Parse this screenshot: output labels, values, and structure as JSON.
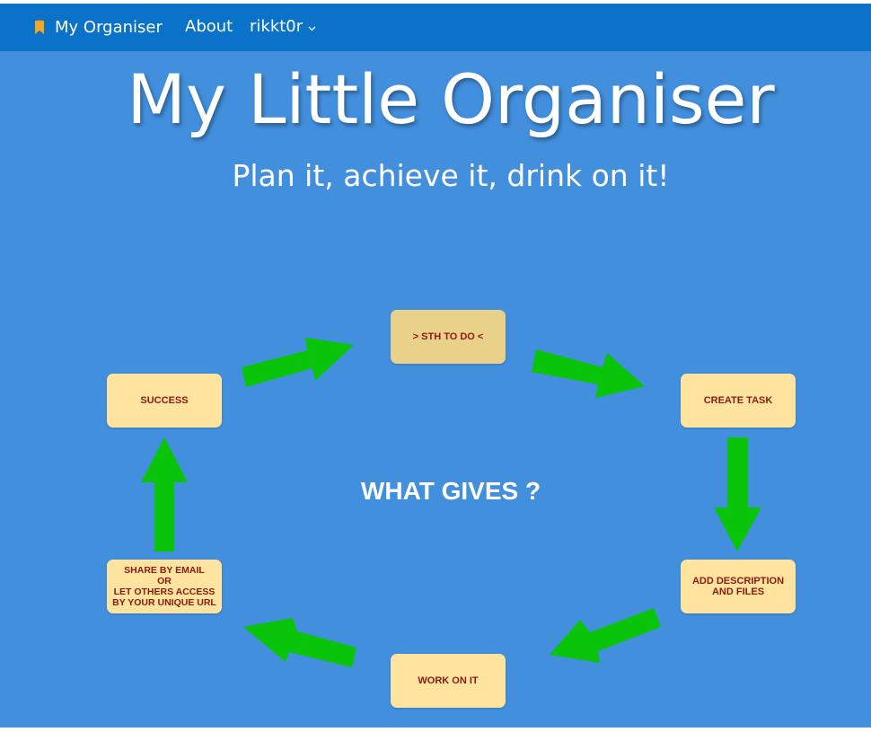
{
  "navbar": {
    "brand_label": "My Organiser",
    "brand_icon": "bookmark-icon",
    "about_label": "About",
    "user_label": "rikkt0r",
    "user_icon": "chevron-down-icon"
  },
  "hero": {
    "title": "My Little Organiser",
    "subtitle": "Plan it, achieve it, drink on it!"
  },
  "cycle": {
    "center_label": "WHAT GIVES ?",
    "steps": {
      "sth_to_do": "> STH TO DO <",
      "create_task": "CREATE TASK",
      "add_description_lines": [
        "ADD DESCRIPTION",
        "AND FILES"
      ],
      "work_on_it": "WORK ON IT",
      "share_lines": [
        "SHARE BY EMAIL",
        "OR",
        "LET OTHERS ACCESS",
        "BY YOUR UNIQUE URL"
      ],
      "success": "SUCCESS"
    },
    "arrow_icon": "arrow-icon"
  },
  "colors": {
    "navbar_bg": "#0a72c9",
    "hero_bg": "#428fdd",
    "step_bg": "#ffe49f",
    "step_active_bg": "#ead18a",
    "step_text": "#8b1a12",
    "arrow": "#0ac40a",
    "bookmark": "#f5a623"
  }
}
